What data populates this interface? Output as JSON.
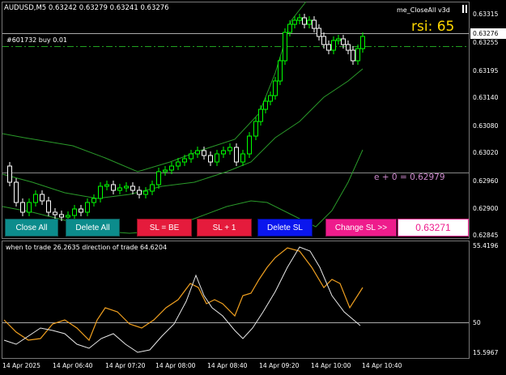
{
  "chart": {
    "symbol_label": "AUDUSD,M5  0.63242 0.63279 0.63241 0.63276",
    "ea_name": "me_CloseAll v3d",
    "rsi_label": "rsi: 65",
    "order_label": "#601732 buy 0.01",
    "equity_label": "e + 0   = 0.62979",
    "sub_label": "when to trade 26.2635  direction of trade 64.6204",
    "price_scale": [
      "0.63315",
      "0.63255",
      "0.63195",
      "0.63140",
      "0.63080",
      "0.63020",
      "0.62960",
      "0.62900",
      "0.62845"
    ],
    "current_price": "0.63276",
    "sub_scale": [
      "55.4196",
      "50",
      "15.5967"
    ],
    "time_labels": [
      "14 Apr 2025",
      "14 Apr 06:40",
      "14 Apr 07:20",
      "14 Apr 08:00",
      "14 Apr 08:40",
      "14 Apr 09:20",
      "14 Apr 10:00",
      "14 Apr 10:40"
    ],
    "colors": {
      "bull": "#00ff00",
      "bear": "#ffffff",
      "band": "#2a9a2a",
      "orange_line": "#f0a020",
      "white_line": "#e8e8e8",
      "rsi": "#ffd700"
    }
  },
  "buttons": {
    "close_all": "Close All",
    "delete_all": "Delete All",
    "sl_be": "SL = BE",
    "sl_plus_1": "SL + 1",
    "delete_sl": "Delete SL",
    "change_sl": "Change SL >>",
    "sl_input_value": "0.63271"
  },
  "window": {
    "controls_icon": "pause-icon"
  }
}
